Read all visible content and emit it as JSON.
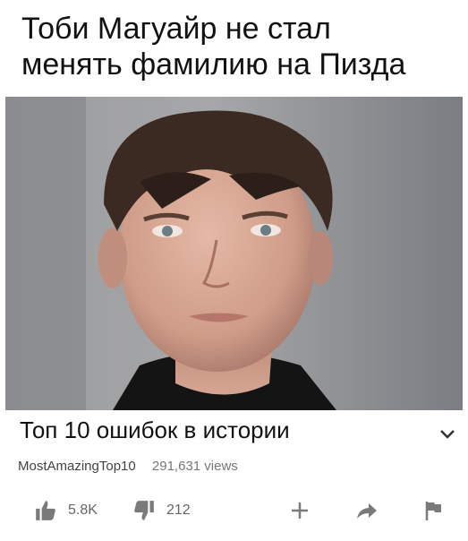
{
  "caption": {
    "line1": "Тоби Магуайр не стал",
    "line2": "менять фамилию на Пизда"
  },
  "video": {
    "title": "Топ 10 ошибок в истории",
    "channel": "MostAmazingTop10",
    "views": "291,631 views"
  },
  "actions": {
    "likes": "5.8K",
    "dislikes": "212"
  },
  "icons": [
    "chevron-down-icon",
    "thumbs-up-icon",
    "thumbs-down-icon",
    "plus-icon",
    "share-icon",
    "flag-icon"
  ],
  "colors": {
    "icon": "#7a7a7a",
    "text": "#111111",
    "meta": "#666666"
  }
}
